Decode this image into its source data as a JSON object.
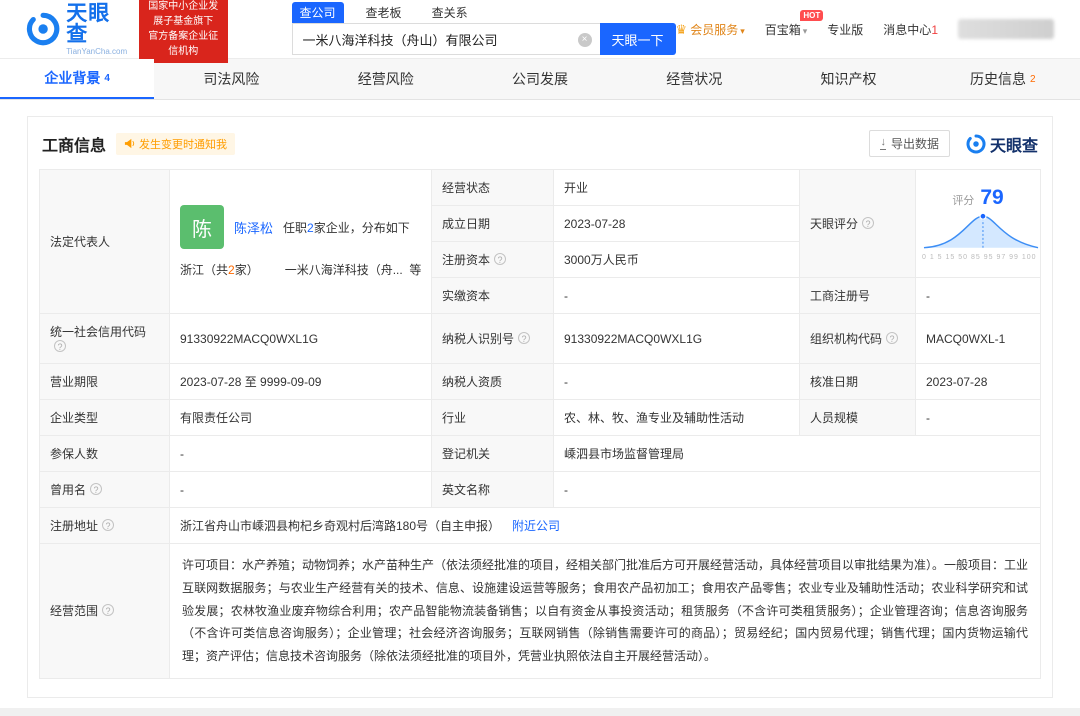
{
  "header": {
    "logo": {
      "brand": "天眼查",
      "sub": "TianYanCha.com"
    },
    "gov_badge": {
      "line1": "国家中小企业发展子基金旗下",
      "line2": "官方备案企业征信机构"
    },
    "search": {
      "tab_company": "查公司",
      "tab_boss": "查老板",
      "tab_relation": "查关系",
      "value": "一米八海洋科技（舟山）有限公司",
      "button": "天眼一下"
    },
    "vip": "会员服务",
    "toolbox": "百宝箱",
    "hot": "HOT",
    "pro": "专业版",
    "messages": "消息中心",
    "messages_count": "1"
  },
  "nav": {
    "tabs": [
      {
        "label": "企业背景",
        "count": "4"
      },
      {
        "label": "司法风险",
        "count": ""
      },
      {
        "label": "经营风险",
        "count": ""
      },
      {
        "label": "公司发展",
        "count": ""
      },
      {
        "label": "经营状况",
        "count": ""
      },
      {
        "label": "知识产权",
        "count": ""
      },
      {
        "label": "历史信息",
        "count": "2"
      }
    ]
  },
  "section": {
    "title": "工商信息",
    "notify": "发生变更时通知我",
    "export": "导出数据",
    "watermark": "天眼查"
  },
  "biz": {
    "legal_rep_label": "法定代表人",
    "legal_rep": {
      "avatar": "陈",
      "name": "陈泽松",
      "desc_pre": "任职",
      "desc_count": "2",
      "desc_post": "家企业，分布如下",
      "region_pre": "浙江（共",
      "region_count": "2",
      "region_post": "家）",
      "more": "一米八海洋科技（舟...",
      "more_tail": "等"
    },
    "status_label": "经营状态",
    "status": "开业",
    "founded_label": "成立日期",
    "founded": "2023-07-28",
    "reg_capital_label": "注册资本",
    "reg_capital": "3000万人民币",
    "paid_capital_label": "实缴资本",
    "paid_capital": "-",
    "score_label": "天眼评分",
    "score_caption": "评分",
    "score": "79",
    "score_ticks": "0 1 5 15 50 85 95 97 99 100",
    "reg_no_label": "工商注册号",
    "reg_no": "-",
    "credit_code_label": "统一社会信用代码",
    "credit_code": "91330922MACQ0WXL1G",
    "taxpayer_id_label": "纳税人识别号",
    "taxpayer_id": "91330922MACQ0WXL1G",
    "org_code_label": "组织机构代码",
    "org_code": "MACQ0WXL-1",
    "term_label": "营业期限",
    "term": "2023-07-28 至 9999-09-09",
    "taxpayer_quality_label": "纳税人资质",
    "taxpayer_quality": "-",
    "approved_label": "核准日期",
    "approved": "2023-07-28",
    "type_label": "企业类型",
    "type": "有限责任公司",
    "industry_label": "行业",
    "industry": "农、林、牧、渔专业及辅助性活动",
    "staff_label": "人员规模",
    "staff": "-",
    "insured_label": "参保人数",
    "insured": "-",
    "authority_label": "登记机关",
    "authority": "嵊泗县市场监督管理局",
    "former_label": "曾用名",
    "former": "-",
    "english_label": "英文名称",
    "english": "-",
    "address_label": "注册地址",
    "address": "浙江省舟山市嵊泗县枸杞乡奇观村后湾路180号（自主申报）",
    "nearby": "附近公司",
    "scope_label": "经营范围",
    "scope": "许可项目：水产养殖；动物饲养；水产苗种生产（依法须经批准的项目，经相关部门批准后方可开展经营活动，具体经营项目以审批结果为准）。一般项目：工业互联网数据服务；与农业生产经营有关的技术、信息、设施建设运营等服务；食用农产品初加工；食用农产品零售；农业专业及辅助性活动；农业科学研究和试验发展；农林牧渔业废弃物综合利用；农产品智能物流装备销售；以自有资金从事投资活动；租赁服务（不含许可类租赁服务）；企业管理咨询；信息咨询服务（不含许可类信息咨询服务）；企业管理；社会经济咨询服务；互联网销售（除销售需要许可的商品）；贸易经纪；国内贸易代理；销售代理；国内货物运输代理；资产评估；信息技术咨询服务（除依法须经批准的项目外，凭营业执照依法自主开展经营活动）。"
  },
  "colors": {
    "accent": "#1a66ff",
    "link": "#1a66ff",
    "red": "#d9251c",
    "orange": "#ff9d00",
    "green": "#5bbe6e"
  }
}
